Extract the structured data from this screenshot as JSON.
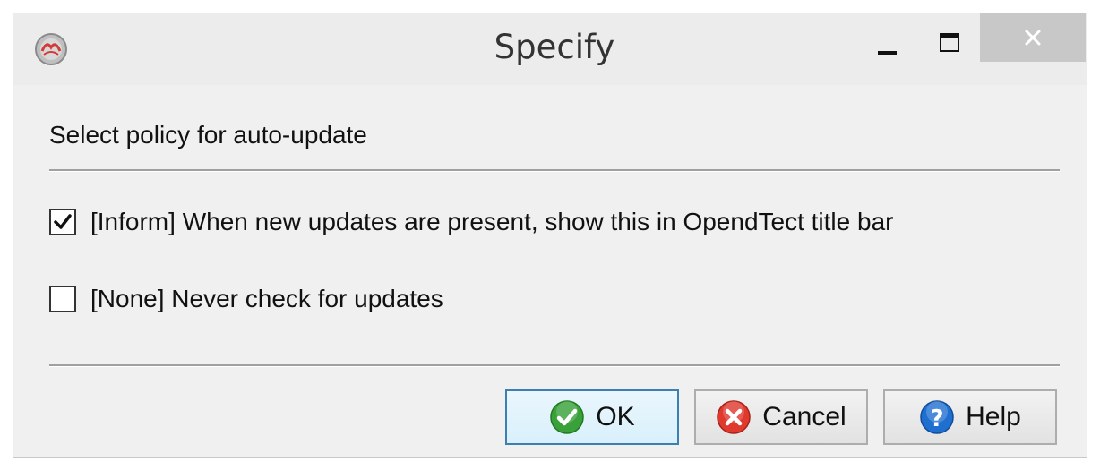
{
  "window": {
    "title": "Specify",
    "app_icon": "opendtect-app-icon",
    "controls": {
      "minimize_icon": "minimize-icon",
      "maximize_icon": "maximize-icon",
      "close_icon": "close-icon"
    }
  },
  "dialog": {
    "heading": "Select policy for auto-update",
    "options": [
      {
        "label": "[Inform] When new updates are present, show this in OpendTect title bar",
        "checked": true
      },
      {
        "label": "[None] Never check for updates",
        "checked": false
      }
    ],
    "buttons": {
      "ok": {
        "label": "OK",
        "icon": "green-check-icon"
      },
      "cancel": {
        "label": "Cancel",
        "icon": "red-x-icon"
      },
      "help": {
        "label": "Help",
        "icon": "blue-question-icon"
      }
    }
  },
  "colors": {
    "ok_icon": "#3aa13a",
    "cancel_icon": "#e03a2f",
    "help_icon": "#1f6fd0",
    "default_button_border": "#3c7fb1"
  }
}
